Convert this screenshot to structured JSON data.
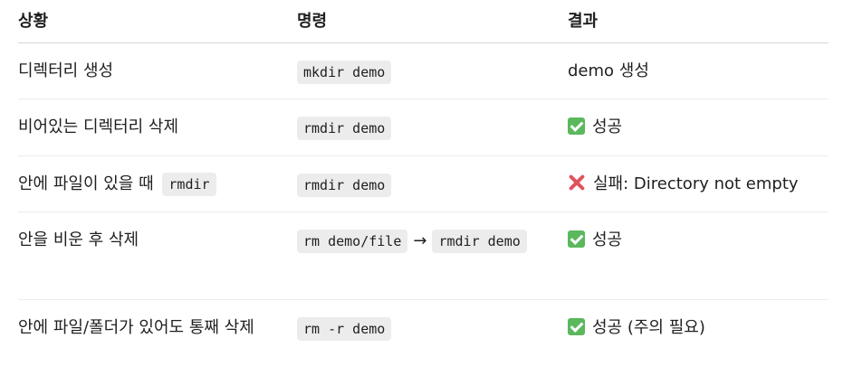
{
  "table": {
    "headers": [
      "상황",
      "명령",
      "결과"
    ],
    "rows": [
      {
        "situation": "디렉터리 생성",
        "command": "mkdir demo",
        "result": "demo 생성",
        "result_icon": "none"
      },
      {
        "situation": "비어있는 디렉터리 삭제",
        "command": "rmdir demo",
        "result": "성공",
        "result_icon": "check-icon"
      },
      {
        "situation": "안에 파일이 있을 때",
        "situation_code": "rmdir",
        "command": "rmdir demo",
        "result": "실패: Directory not empty",
        "result_icon": "cross-icon"
      },
      {
        "situation": "안을 비운 후 삭제",
        "command_part1": "rm demo/file",
        "command_arrow": "→",
        "command_part2": "rmdir demo",
        "result": "성공",
        "result_icon": "check-icon"
      },
      {
        "situation": "안에 파일/폴더가 있어도 통째 삭제",
        "command": "rm -r demo",
        "result": "성공 (주의 필요)",
        "result_icon": "check-icon"
      }
    ]
  },
  "colors": {
    "check": "#5bb85d",
    "cross": "#e0525c",
    "code_bg": "#ececec"
  }
}
